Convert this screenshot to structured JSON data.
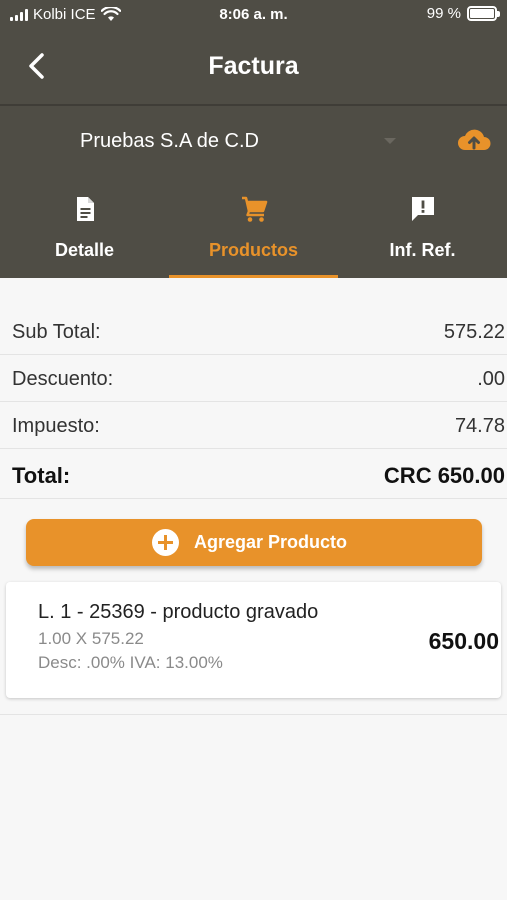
{
  "status_bar": {
    "carrier": "Kolbi ICE",
    "time": "8:06 a. m.",
    "battery": "99 %"
  },
  "app_bar": {
    "title": "Factura"
  },
  "company_selector": {
    "value": "Pruebas S.A de C.D"
  },
  "tabs": [
    {
      "label": "Detalle",
      "icon": "document-icon",
      "active": false
    },
    {
      "label": "Productos",
      "icon": "cart-icon",
      "active": true
    },
    {
      "label": "Inf. Ref.",
      "icon": "alert-message-icon",
      "active": false
    }
  ],
  "summary": {
    "subtotal_label": "Sub Total:",
    "subtotal_value": "575.22",
    "discount_label": "Descuento:",
    "discount_value": ".00",
    "tax_label": "Impuesto:",
    "tax_value": "74.78",
    "total_label": "Total:",
    "total_value": "CRC 650.00"
  },
  "add_product_button": {
    "label": "Agregar Producto"
  },
  "products": [
    {
      "title": "L. 1 - 25369 - producto gravado",
      "quantity_line": "1.00 X 575.22",
      "discount_line": "Desc: .00% IVA: 13.00%",
      "total": "650.00"
    }
  ],
  "colors": {
    "header_bg": "#4f4d45",
    "accent": "#e8922a",
    "page_bg": "#f7f7f7"
  }
}
